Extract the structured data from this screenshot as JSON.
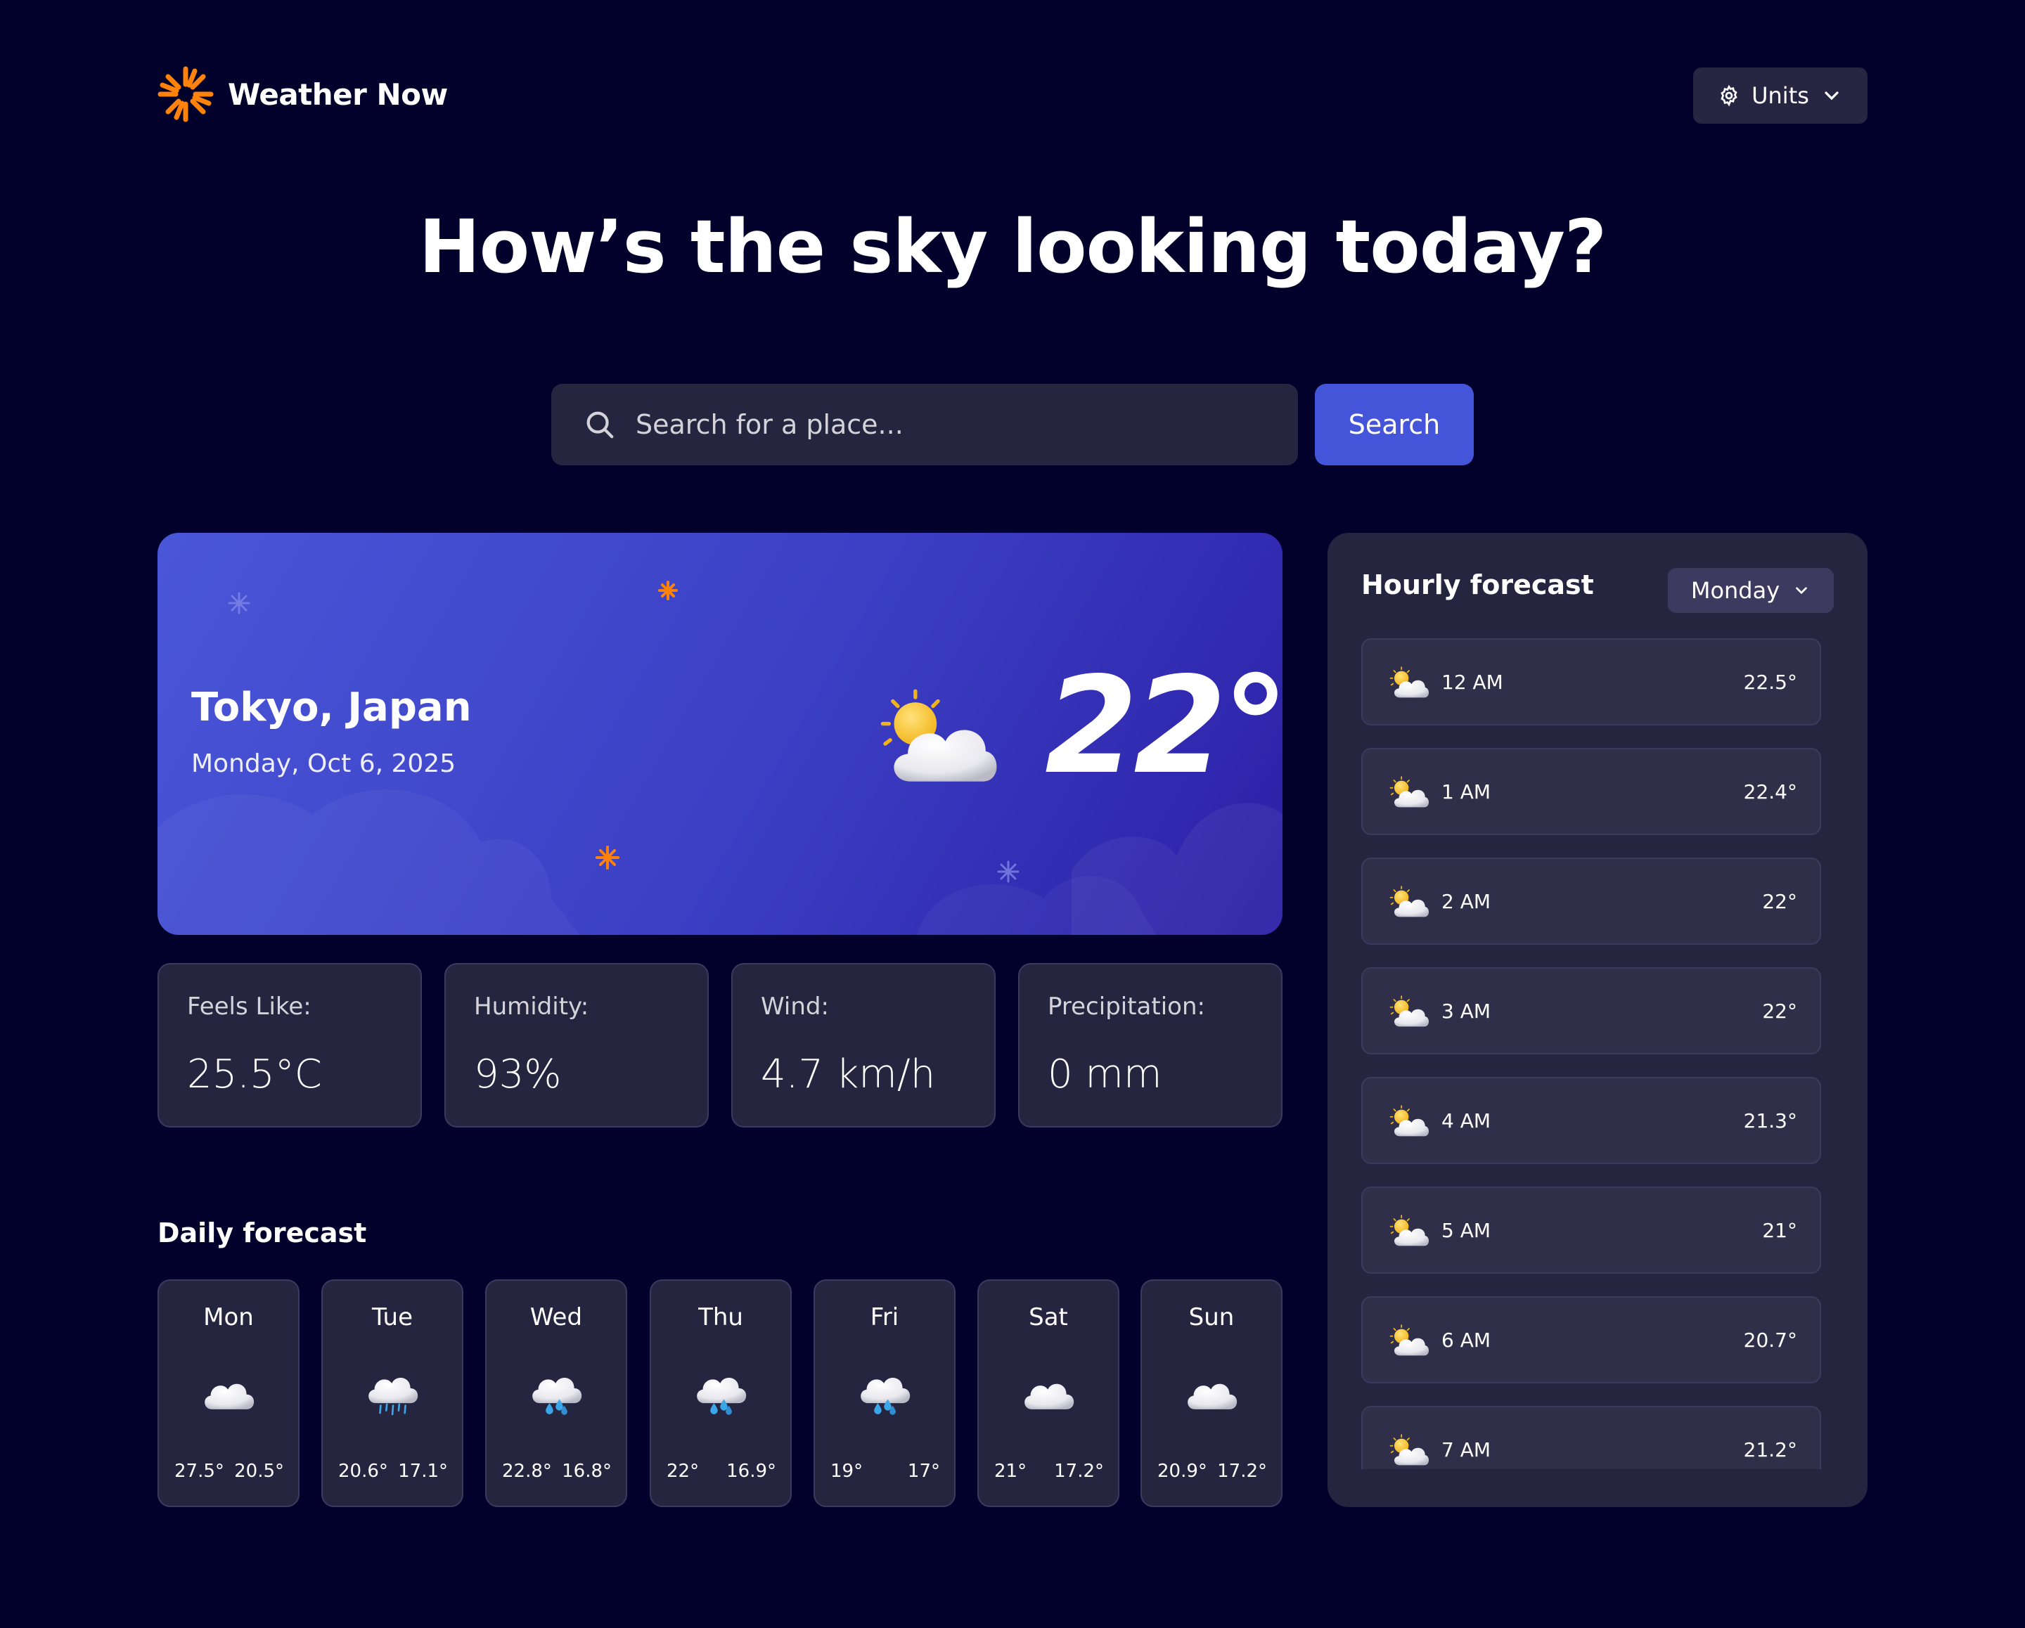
{
  "header": {
    "app_name": "Weather Now",
    "units_label": "Units",
    "accent_color": "#ff820a"
  },
  "hero_title": "How’s the sky looking today?",
  "search": {
    "placeholder": "Search for a place...",
    "button_label": "Search",
    "button_color": "#4455da"
  },
  "current": {
    "location": "Tokyo, Japan",
    "date": "Monday, Oct 6, 2025",
    "temperature": "22°",
    "icon": "partly-cloudy-icon"
  },
  "stats": [
    {
      "label": "Feels Like:",
      "value": "25.5°C"
    },
    {
      "label": "Humidity:",
      "value": "93%"
    },
    {
      "label": "Wind:",
      "value": "4.7 km/h"
    },
    {
      "label": "Precipitation:",
      "value": "0 mm"
    }
  ],
  "daily": {
    "title": "Daily forecast",
    "days": [
      {
        "day": "Mon",
        "icon": "cloud-icon",
        "high": "27.5°",
        "low": "20.5°"
      },
      {
        "day": "Tue",
        "icon": "drizzle-icon",
        "high": "20.6°",
        "low": "17.1°"
      },
      {
        "day": "Wed",
        "icon": "rain-icon",
        "high": "22.8°",
        "low": "16.8°"
      },
      {
        "day": "Thu",
        "icon": "rain-icon",
        "high": "22°",
        "low": "16.9°"
      },
      {
        "day": "Fri",
        "icon": "rain-icon",
        "high": "19°",
        "low": "17°"
      },
      {
        "day": "Sat",
        "icon": "cloud-icon",
        "high": "21°",
        "low": "17.2°"
      },
      {
        "day": "Sun",
        "icon": "cloud-icon",
        "high": "20.9°",
        "low": "17.2°"
      }
    ]
  },
  "hourly": {
    "title": "Hourly forecast",
    "selected_day": "Monday",
    "hours": [
      {
        "time": "12 AM",
        "temp": "22.5°",
        "icon": "partly-cloudy-icon"
      },
      {
        "time": "1 AM",
        "temp": "22.4°",
        "icon": "partly-cloudy-icon"
      },
      {
        "time": "2 AM",
        "temp": "22°",
        "icon": "partly-cloudy-icon"
      },
      {
        "time": "3 AM",
        "temp": "22°",
        "icon": "partly-cloudy-icon"
      },
      {
        "time": "4 AM",
        "temp": "21.3°",
        "icon": "partly-cloudy-icon"
      },
      {
        "time": "5 AM",
        "temp": "21°",
        "icon": "partly-cloudy-icon"
      },
      {
        "time": "6 AM",
        "temp": "20.7°",
        "icon": "partly-cloudy-icon"
      },
      {
        "time": "7 AM",
        "temp": "21.2°",
        "icon": "partly-cloudy-icon"
      }
    ]
  }
}
